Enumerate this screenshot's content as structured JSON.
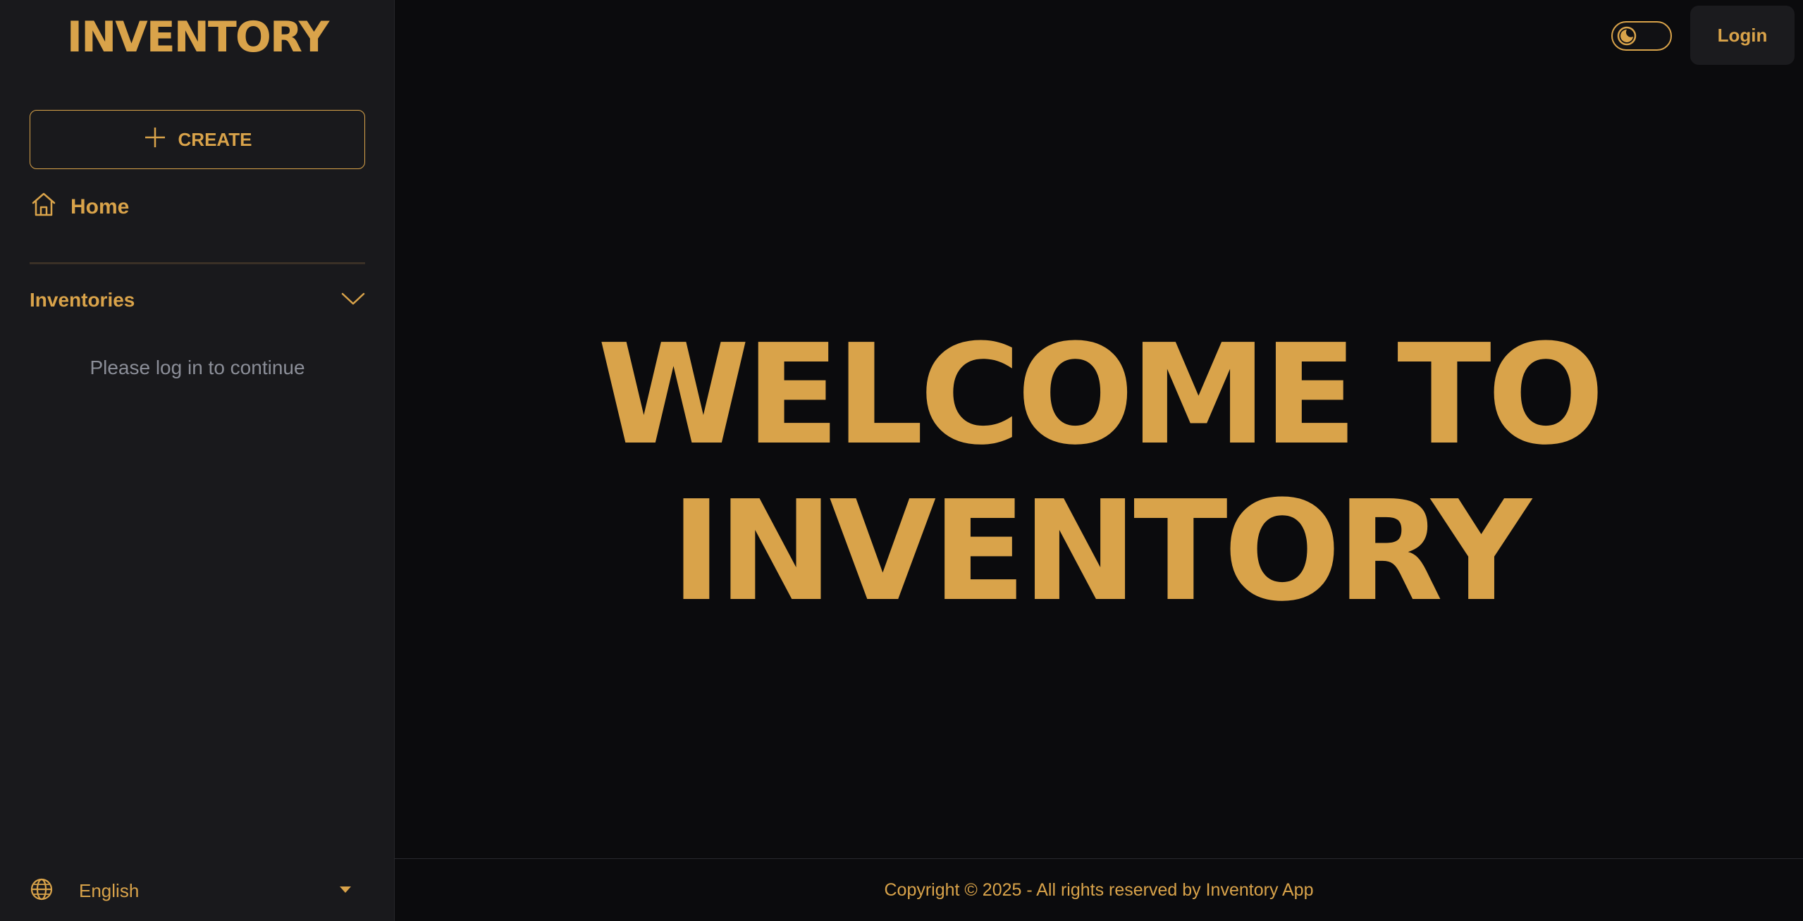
{
  "sidebar": {
    "brand": "INVENTORY",
    "create_label": "CREATE",
    "home_label": "Home",
    "section_title": "Inventories",
    "login_hint": "Please log in to continue",
    "language": "English"
  },
  "header": {
    "login_label": "Login",
    "theme_toggle": "dark"
  },
  "hero": {
    "line1": "WELCOME TO",
    "line2": "INVENTORY"
  },
  "footer": {
    "copyright": "Copyright © 2025 - All rights reserved by Inventory App"
  },
  "colors": {
    "accent": "#d9a34a",
    "background": "#0b0b0d",
    "sidebar": "#19191c",
    "muted_text": "#8b8e98"
  },
  "icons": [
    "plus-icon",
    "home-icon",
    "chevron-down-icon",
    "moon-icon",
    "globe-icon",
    "caret-down-icon"
  ]
}
